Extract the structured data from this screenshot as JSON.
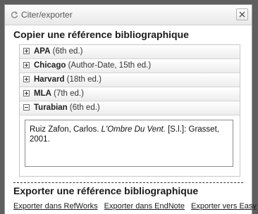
{
  "dialog": {
    "title": "Citer/exporter",
    "close_label": "×"
  },
  "cite": {
    "heading": "Copier une référence bibliographique",
    "styles": [
      {
        "name": "APA",
        "edition": "(6th ed.)",
        "expanded": false
      },
      {
        "name": "Chicago",
        "edition": "(Author-Date, 15th ed.)",
        "expanded": false
      },
      {
        "name": "Harvard",
        "edition": "(18th ed.)",
        "expanded": false
      },
      {
        "name": "MLA",
        "edition": "(7th ed.)",
        "expanded": false
      },
      {
        "name": "Turabian",
        "edition": "(6th ed.)",
        "expanded": true
      }
    ],
    "citation": {
      "author": "Ruiz Zafon, Carlos.",
      "title": "L'Ombre Du Vent.",
      "publication": "[S.l.]: Grasset, 2001."
    }
  },
  "export": {
    "heading": "Exporter une référence bibliographique",
    "links": [
      "Exporter dans RefWorks",
      "Exporter dans EndNote",
      "Exporter vers Easy"
    ]
  }
}
